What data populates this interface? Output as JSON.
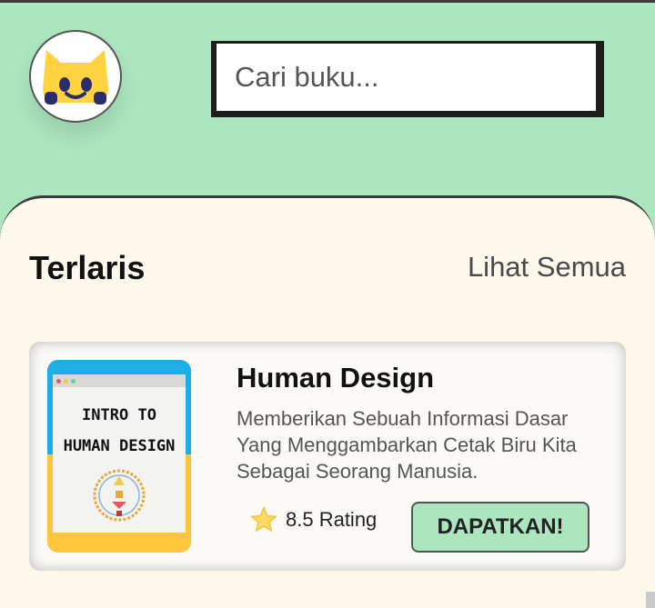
{
  "search": {
    "placeholder": "Cari buku..."
  },
  "section": {
    "title": "Terlaris",
    "see_all": "Lihat Semua"
  },
  "book": {
    "cover_title_line1": "INTRO TO",
    "cover_title_line2": "HUMAN DESIGN",
    "title": "Human Design",
    "description": "Memberikan Sebuah Informasi Dasar Yang Menggambarkan Cetak Biru Kita Sebagai Seorang Manusia.",
    "rating_text": "8.5 Rating",
    "cta_label": "DAPATKAN!"
  },
  "colors": {
    "header_bg": "#abe6bf",
    "panel_bg": "#fdf8ec",
    "cta_bg": "#abe6bf",
    "avatar_yellow": "#ffd23f",
    "avatar_navy": "#2b2d6b"
  }
}
